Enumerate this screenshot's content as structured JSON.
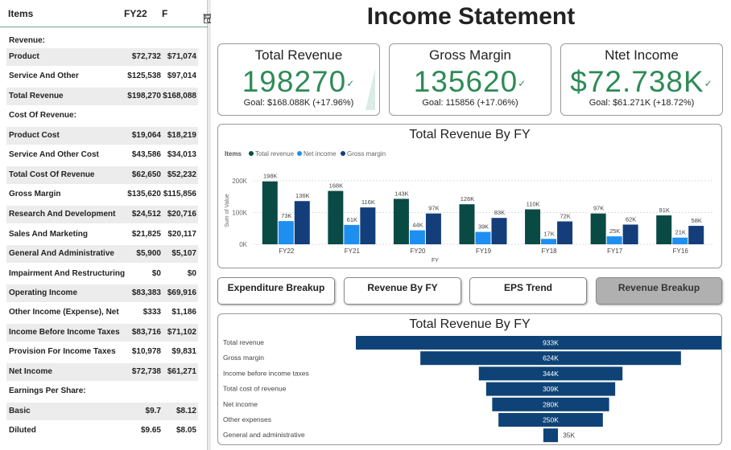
{
  "financials": {
    "headers": {
      "items": "Items",
      "col1": "FY22",
      "col2": "F"
    },
    "rows": [
      {
        "label": "Revenue:",
        "v1": "",
        "v2": ""
      },
      {
        "label": "Product",
        "v1": "$72,732",
        "v2": "$71,074"
      },
      {
        "label": "Service And Other",
        "v1": "$125,538",
        "v2": "$97,014"
      },
      {
        "label": "Total Revenue",
        "v1": "$198,270",
        "v2": "$168,088"
      },
      {
        "label": "Cost Of Revenue:",
        "v1": "",
        "v2": ""
      },
      {
        "label": "Product Cost",
        "v1": "$19,064",
        "v2": "$18,219"
      },
      {
        "label": "Service And Other Cost",
        "v1": "$43,586",
        "v2": "$34,013"
      },
      {
        "label": "Total Cost Of Revenue",
        "v1": "$62,650",
        "v2": "$52,232"
      },
      {
        "label": "Gross Margin",
        "v1": "$135,620",
        "v2": "$115,856"
      },
      {
        "label": "Research And Development",
        "v1": "$24,512",
        "v2": "$20,716"
      },
      {
        "label": "Sales And Marketing",
        "v1": "$21,825",
        "v2": "$20,117"
      },
      {
        "label": "General And Administrative",
        "v1": "$5,900",
        "v2": "$5,107"
      },
      {
        "label": "Impairment And Restructuring",
        "v1": "$0",
        "v2": "$0"
      },
      {
        "label": "Operating Income",
        "v1": "$83,383",
        "v2": "$69,916"
      },
      {
        "label": "Other Income (Expense), Net",
        "v1": "$333",
        "v2": "$1,186"
      },
      {
        "label": "Income Before Income Taxes",
        "v1": "$83,716",
        "v2": "$71,102"
      },
      {
        "label": "Provision For Income Taxes",
        "v1": "$10,978",
        "v2": "$9,831"
      },
      {
        "label": "Net Income",
        "v1": "$72,738",
        "v2": "$61,271"
      },
      {
        "label": "Earnings Per Share:",
        "v1": "",
        "v2": ""
      },
      {
        "label": "Basic",
        "v1": "$9.7",
        "v2": "$8.12"
      },
      {
        "label": "Diluted",
        "v1": "$9.65",
        "v2": "$8.05"
      }
    ],
    "icons": [
      "filter-icon",
      "focus-mode-icon",
      "more-options-icon"
    ]
  },
  "page_title": "Income Statement",
  "kpis": [
    {
      "title": "Total Revenue",
      "value": "198270",
      "goal": "Goal: $168.088K (+17.96%)"
    },
    {
      "title": "Gross Margin",
      "value": "135620",
      "goal": "Goal: 115856 (+17.06%)"
    },
    {
      "title": "Ntet Income",
      "value": "$72.738K",
      "goal": "Goal: $61.271K (+18.72%)"
    }
  ],
  "buttons": [
    {
      "label": "Expenditure Breakup",
      "selected": false
    },
    {
      "label": "Revenue By FY",
      "selected": false
    },
    {
      "label": "EPS Trend",
      "selected": false
    },
    {
      "label": "Revenue Breakup",
      "selected": true
    }
  ],
  "colors": {
    "kpi_value": "#2e8b57",
    "total_revenue": "#0a4a44",
    "net_income": "#1e8ef0",
    "gross_margin": "#133e7a",
    "funnel": "#0f4377"
  },
  "chart_data": [
    {
      "type": "bar",
      "title": "Total Revenue By FY",
      "legend_title": "Items",
      "legend_position": "top-left",
      "xlabel": "FY",
      "ylabel": "Sum of Value",
      "categories": [
        "FY22",
        "FY21",
        "FY20",
        "FY19",
        "FY18",
        "FY17",
        "FY16"
      ],
      "series": [
        {
          "name": "Total revenue",
          "values": [
            198,
            168,
            143,
            126,
            110,
            97,
            91
          ],
          "labels": [
            "198K",
            "168K",
            "143K",
            "126K",
            "110K",
            "97K",
            "91K"
          ]
        },
        {
          "name": "Net income",
          "values": [
            73,
            61,
            44,
            39,
            17,
            25,
            21
          ],
          "labels": [
            "73K",
            "61K",
            "44K",
            "39K",
            "17K",
            "25K",
            "21K"
          ]
        },
        {
          "name": "Gross margin",
          "values": [
            136,
            116,
            97,
            83,
            72,
            62,
            58
          ],
          "labels": [
            "136K",
            "116K",
            "97K",
            "83K",
            "72K",
            "62K",
            "58K"
          ]
        }
      ],
      "y_ticks": [
        "0K",
        "100K",
        "200K"
      ],
      "ylim": [
        0,
        215
      ],
      "grid": true
    },
    {
      "type": "bar",
      "orientation": "funnel",
      "title": "Total Revenue By FY",
      "categories": [
        "Total revenue",
        "Gross margin",
        "Income before income taxes",
        "Total cost of revenue",
        "Net income",
        "Other expenses",
        "General and administrative"
      ],
      "values": [
        933,
        624,
        344,
        309,
        280,
        250,
        35
      ],
      "labels": [
        "933K",
        "624K",
        "344K",
        "309K",
        "280K",
        "250K",
        "35K"
      ]
    }
  ]
}
